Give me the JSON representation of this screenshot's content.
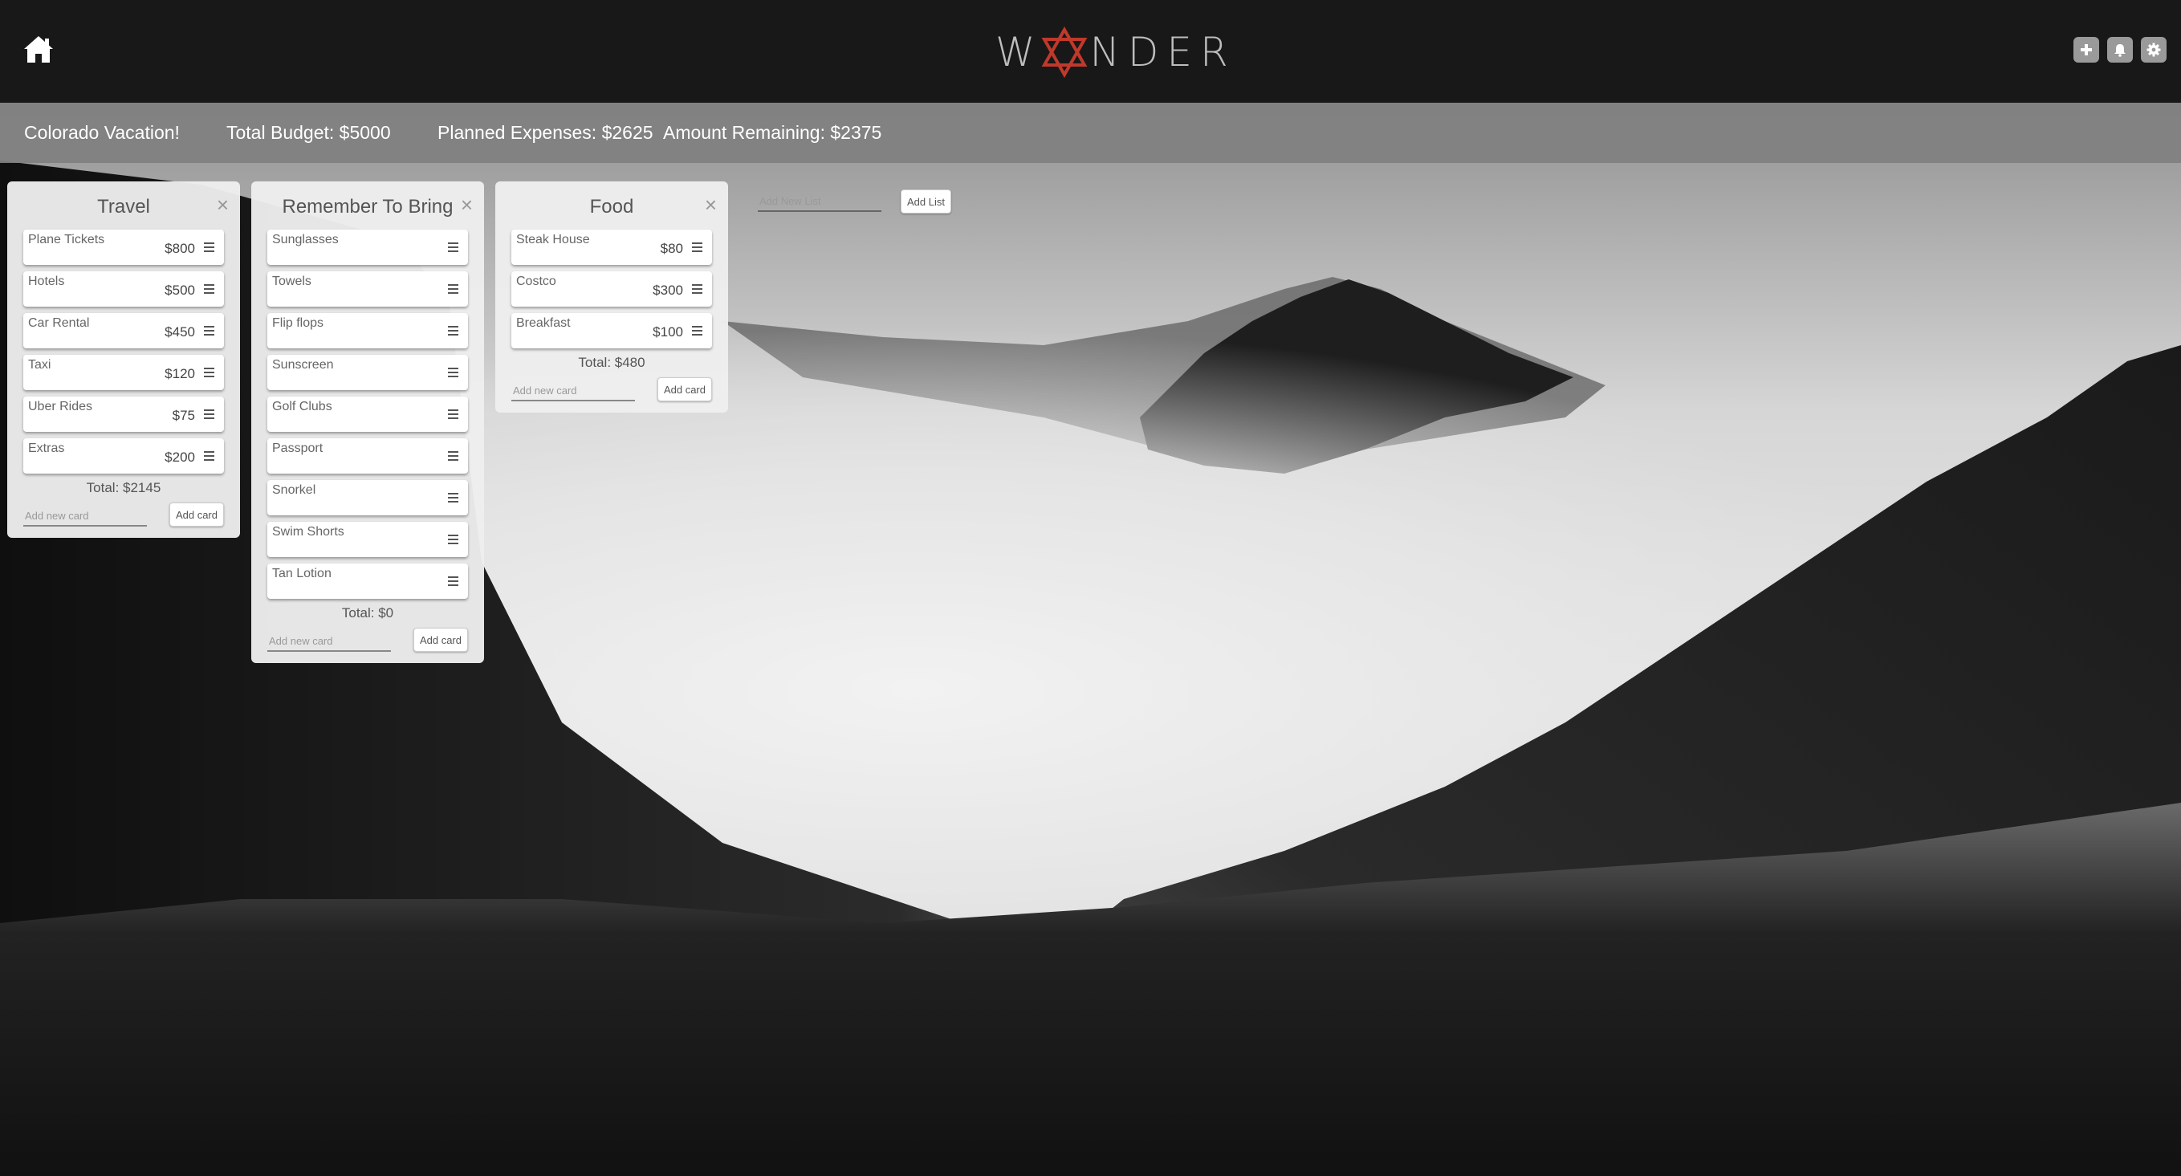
{
  "app": {
    "logo_text": "WANDER",
    "logo_left": "W",
    "logo_right": "NDER",
    "accent_color": "#c0392b"
  },
  "nav": {
    "home_icon": "home-icon",
    "right_icons": [
      "plus-icon",
      "bell-icon",
      "gear-icon"
    ]
  },
  "budget": {
    "trip_name": "Colorado Vacation!",
    "total_budget": "Total Budget: $5000",
    "planned_expenses": "Planned Expenses: $2625",
    "amount_remaining": "Amount Remaining: $2375"
  },
  "lists": [
    {
      "title": "Travel",
      "cards": [
        {
          "name": "Plane Tickets",
          "price": "$800"
        },
        {
          "name": "Hotels",
          "price": "$500"
        },
        {
          "name": "Car Rental",
          "price": "$450"
        },
        {
          "name": "Taxi",
          "price": "$120"
        },
        {
          "name": "Uber Rides",
          "price": "$75"
        },
        {
          "name": "Extras",
          "price": "$200"
        }
      ],
      "total": "Total: $2145",
      "add_placeholder": "Add new card",
      "add_label": "Add card"
    },
    {
      "title": "Remember To Bring",
      "cards": [
        {
          "name": "Sunglasses",
          "price": ""
        },
        {
          "name": "Towels",
          "price": ""
        },
        {
          "name": "Flip flops",
          "price": ""
        },
        {
          "name": "Sunscreen",
          "price": ""
        },
        {
          "name": "Golf Clubs",
          "price": ""
        },
        {
          "name": "Passport",
          "price": ""
        },
        {
          "name": "Snorkel",
          "price": ""
        },
        {
          "name": "Swim Shorts",
          "price": ""
        },
        {
          "name": "Tan Lotion",
          "price": ""
        }
      ],
      "total": "Total: $0",
      "add_placeholder": "Add new card",
      "add_label": "Add card"
    },
    {
      "title": "Food",
      "cards": [
        {
          "name": "Steak House",
          "price": "$80"
        },
        {
          "name": "Costco",
          "price": "$300"
        },
        {
          "name": "Breakfast",
          "price": "$100"
        }
      ],
      "total": "Total: $480",
      "add_placeholder": "Add new card",
      "add_label": "Add card"
    }
  ],
  "add_list": {
    "placeholder": "Add New List",
    "label": "Add List"
  }
}
